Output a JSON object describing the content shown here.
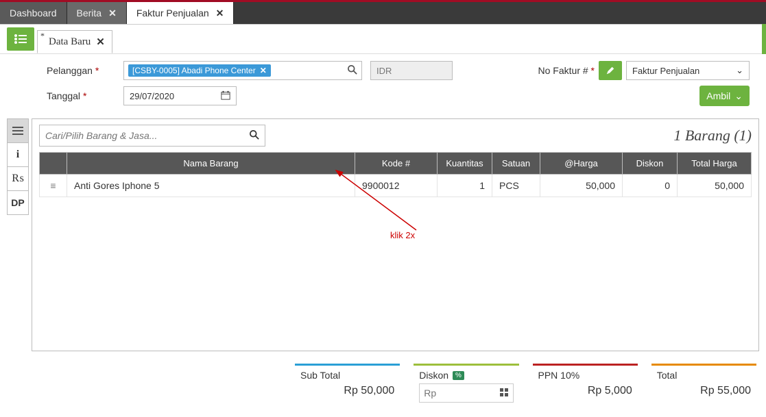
{
  "tabs": {
    "dashboard": "Dashboard",
    "berita": "Berita",
    "faktur": "Faktur Penjualan"
  },
  "subtab": "Data Baru",
  "form": {
    "pelanggan_label": "Pelanggan",
    "pelanggan_chip": "[CSBY-0005] Abadi Phone Center",
    "currency": "IDR",
    "no_faktur_label": "No Faktur #",
    "no_faktur_type": "Faktur Penjualan",
    "tanggal_label": "Tanggal",
    "tanggal_value": "29/07/2020",
    "ambil": "Ambil"
  },
  "search_placeholder": "Cari/Pilih Barang & Jasa...",
  "count_text": "1 Barang (1)",
  "vtabs": {
    "dp": "DP"
  },
  "cols": {
    "nama": "Nama Barang",
    "kode": "Kode #",
    "kuantitas": "Kuantitas",
    "satuan": "Satuan",
    "harga": "@Harga",
    "diskon": "Diskon",
    "total": "Total Harga"
  },
  "row": {
    "nama": "Anti Gores Iphone 5",
    "kode": "9900012",
    "kuantitas": "1",
    "satuan": "PCS",
    "harga": "50,000",
    "diskon": "0",
    "total": "50,000"
  },
  "annot": "klik 2x",
  "totals": {
    "sub_label": "Sub Total",
    "sub_value": "Rp 50,000",
    "disc_label": "Diskon",
    "disc_pct": "%",
    "disc_placeholder": "Rp",
    "ppn_label": "PPN 10%",
    "ppn_value": "Rp 5,000",
    "total_label": "Total",
    "total_value": "Rp 55,000"
  }
}
